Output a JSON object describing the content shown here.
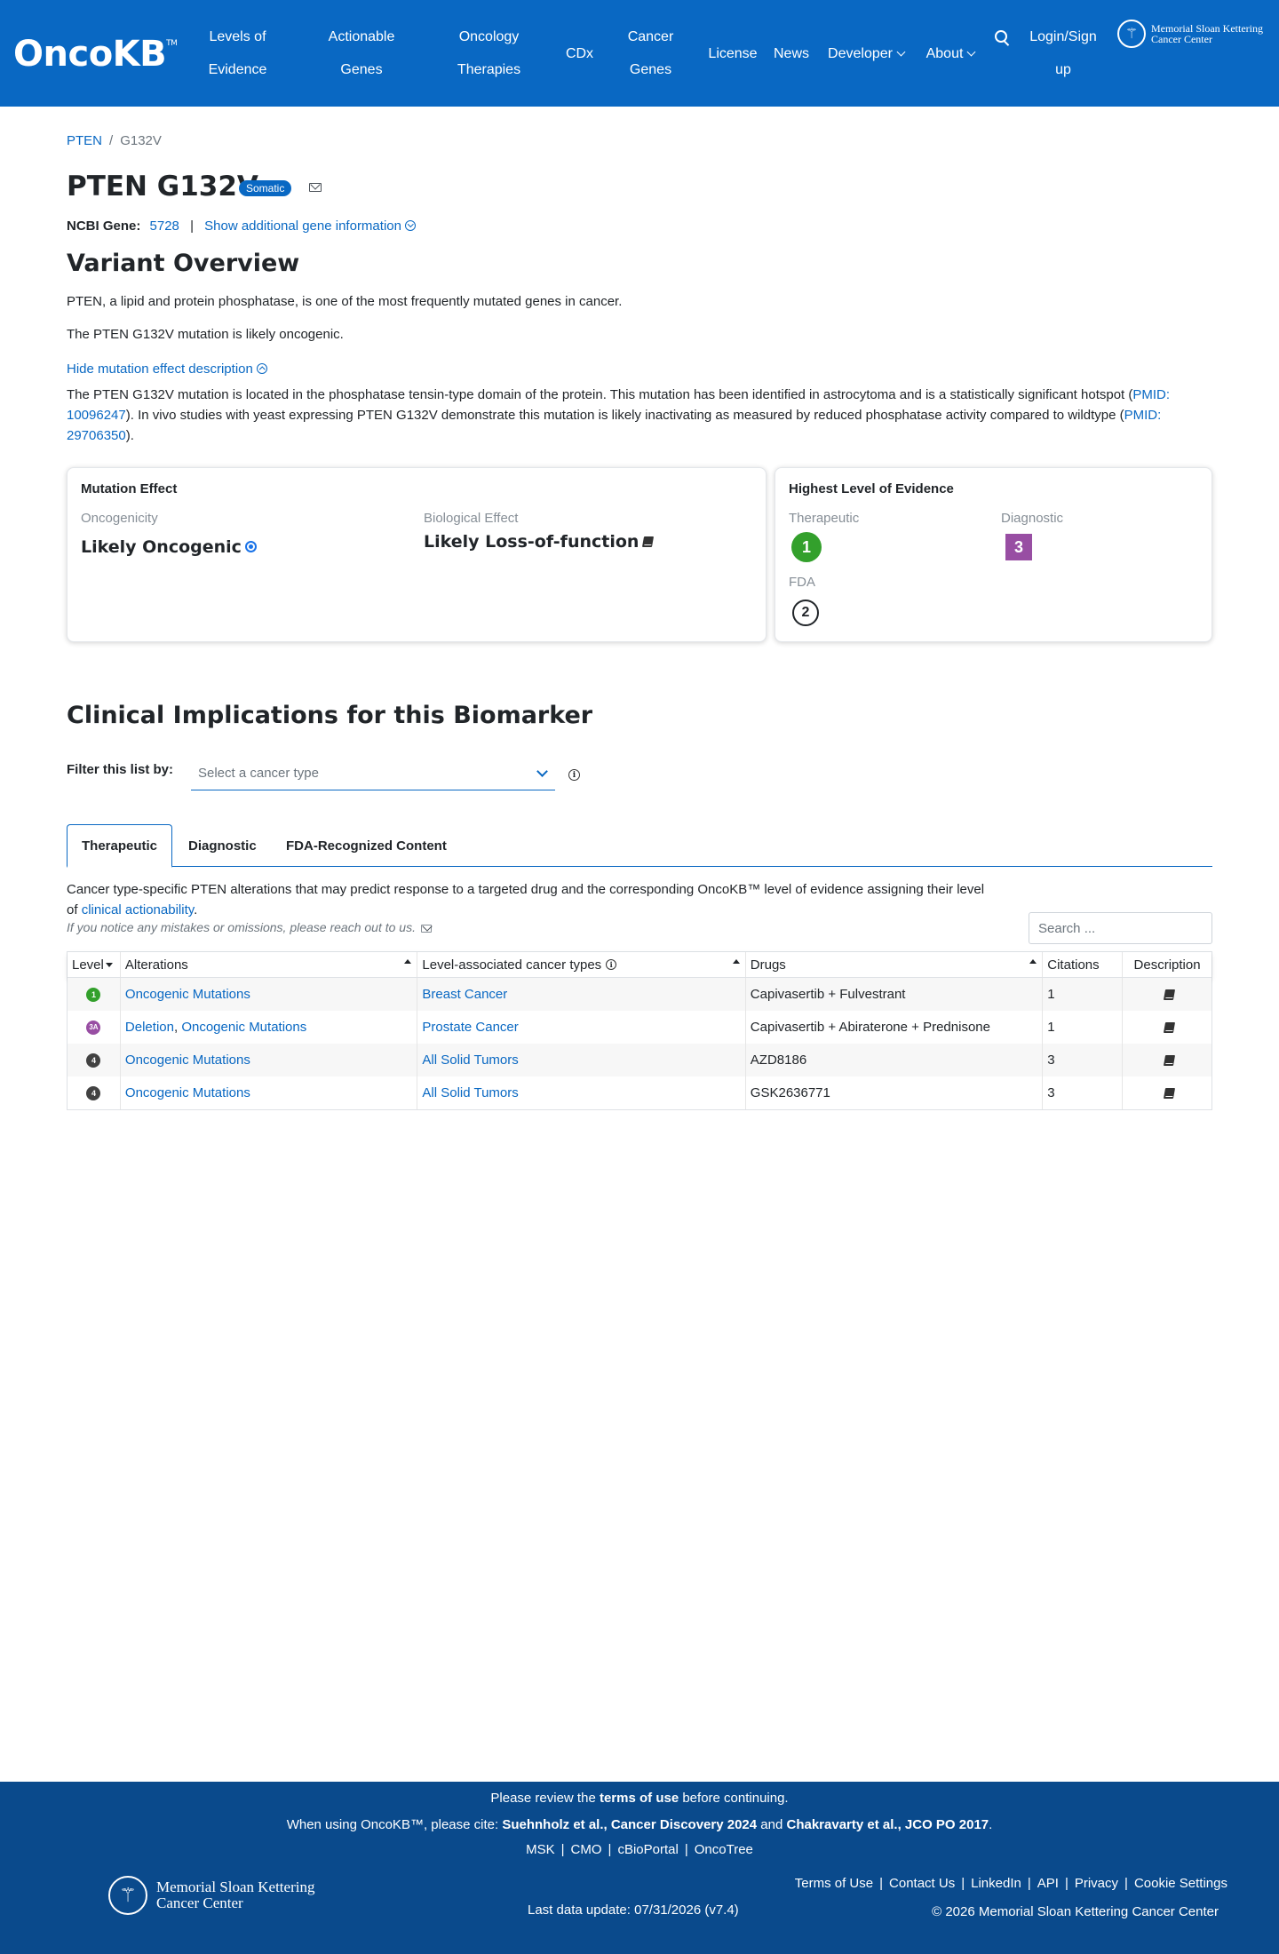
{
  "header": {
    "logo": "OncoKB",
    "logo_tm": "TM",
    "nav": [
      {
        "label": "Levels of Evidence",
        "lines": [
          "Levels of",
          "Evidence"
        ]
      },
      {
        "label": "Actionable Genes",
        "lines": [
          "Actionable",
          "Genes"
        ]
      },
      {
        "label": "Oncology Therapies",
        "lines": [
          "Oncology",
          "Therapies"
        ]
      },
      {
        "label": "CDx",
        "lines": [
          "CDx"
        ]
      },
      {
        "label": "Cancer Genes",
        "lines": [
          "Cancer",
          "Genes"
        ]
      },
      {
        "label": "License",
        "lines": [
          "License"
        ]
      },
      {
        "label": "News",
        "lines": [
          "News"
        ]
      },
      {
        "label": "Developer",
        "lines": [
          "Developer"
        ]
      },
      {
        "label": "About",
        "lines": [
          "About"
        ]
      },
      {
        "label": "Login/Sign up",
        "lines": [
          "Login/Sign",
          "up"
        ]
      }
    ],
    "msk_logo": [
      "Memorial Sloan Kettering",
      "Cancer Center"
    ]
  },
  "breadcrumb": {
    "gene": "PTEN",
    "variant": "G132V"
  },
  "title": "PTEN G132V",
  "badge": "Somatic",
  "ncbi": {
    "label": "NCBI Gene:",
    "id": "5728",
    "sep": "|",
    "more": "Show additional gene information"
  },
  "overview": {
    "heading": "Variant Overview",
    "gene_summary": "PTEN, a lipid and protein phosphatase, is one of the most frequently mutated genes in cancer.",
    "variant_summary": "The PTEN G132V mutation is likely oncogenic.",
    "toggle": "Hide mutation effect description",
    "desc_1": "The PTEN G132V mutation is located in the phosphatase tensin-type domain of the protein. This mutation has been identified in astrocytoma and is a statistically significant hotspot (",
    "pmid_1": "PMID: 10096247",
    "desc_2": "). In vivo studies with yeast expressing PTEN G132V demonstrate this mutation is likely inactivating as measured by reduced phosphatase activity compared to wildtype (",
    "pmid_2": "PMID: 29706350",
    "desc_3": ")."
  },
  "mutation_effect": {
    "title": "Mutation Effect",
    "oncogenicity_label": "Oncogenicity",
    "oncogenicity": "Likely Oncogenic",
    "bio_label": "Biological Effect",
    "bio": "Likely Loss-of-function"
  },
  "highest_level": {
    "title": "Highest Level of Evidence",
    "therapeutic_label": "Therapeutic",
    "therapeutic": "1",
    "diagnostic_label": "Diagnostic",
    "diagnostic": "3",
    "fda_label": "FDA",
    "fda": "2"
  },
  "clinical": {
    "heading": "Clinical Implications for this Biomarker",
    "filter_label": "Filter this list by:",
    "filter_placeholder": "Select a cancer type",
    "tabs": [
      "Therapeutic",
      "Diagnostic",
      "FDA-Recognized Content"
    ],
    "desc_1": "Cancer type-specific PTEN alterations that may predict response to a targeted drug and the corresponding OncoKB™ level of evidence assigning their level of ",
    "desc_link": "clinical actionability",
    "desc_2": ".",
    "notice": "If you notice any mistakes or omissions, please reach out to us.",
    "search_placeholder": "Search ..."
  },
  "table": {
    "headers": [
      "Level",
      "Alterations",
      "Level-associated cancer types",
      "Drugs",
      "Citations",
      "Description"
    ],
    "rows": [
      {
        "level": "1",
        "level_color": "#33a02c",
        "alterations": [
          "Oncogenic Mutations"
        ],
        "cancer": "Breast Cancer",
        "drugs": "Capivasertib + Fulvestrant",
        "citations": "1"
      },
      {
        "level": "3A",
        "level_color": "#984ea3",
        "alterations": [
          "Deletion",
          "Oncogenic Mutations"
        ],
        "cancer": "Prostate Cancer",
        "drugs": "Capivasertib + Abiraterone + Prednisone",
        "citations": "1"
      },
      {
        "level": "4",
        "level_color": "#424242",
        "alterations": [
          "Oncogenic Mutations"
        ],
        "cancer": "All Solid Tumors",
        "drugs": "AZD8186",
        "citations": "3"
      },
      {
        "level": "4",
        "level_color": "#424242",
        "alterations": [
          "Oncogenic Mutations"
        ],
        "cancer": "All Solid Tumors",
        "drugs": "GSK2636771",
        "citations": "3"
      }
    ]
  },
  "footer": {
    "review_1": "Please review the ",
    "review_bold": "terms of use",
    "review_2": " before continuing.",
    "cite_1": "When using OncoKB™, please cite: ",
    "cite_bold_1": "Suehnholz et al., Cancer Discovery 2024",
    "cite_2": " and ",
    "cite_bold_2": "Chakravarty et al., JCO PO 2017",
    "cite_3": ".",
    "links": [
      "MSK",
      "CMO",
      "cBioPortal",
      "OncoTree"
    ],
    "right_links": [
      "Terms of Use",
      "Contact Us",
      "LinkedIn",
      "API",
      "Privacy",
      "Cookie Settings"
    ],
    "last_update": "Last data update: 07/31/2026 (v7.4)",
    "copyright": "© 2026 Memorial Sloan Kettering Cancer Center",
    "msk_logo": [
      "Memorial Sloan Kettering",
      "Cancer Center"
    ]
  },
  "colors": {
    "brand": "#0968c3",
    "footer": "#0a4a8c",
    "level1": "#33a02c",
    "level3": "#984ea3"
  }
}
